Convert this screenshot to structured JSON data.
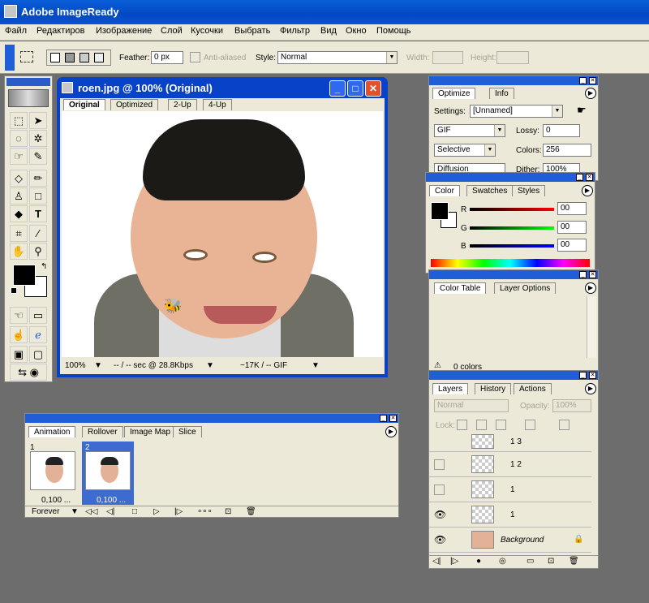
{
  "app": {
    "title": "Adobe ImageReady"
  },
  "menu": [
    "Файл",
    "Редактиров",
    "Изображение",
    "Слой",
    "Кусочки",
    "Выбрать",
    "Фильтр",
    "Вид",
    "Окно",
    "Помощь"
  ],
  "options": {
    "feather_label": "Feather:",
    "feather_value": "0 px",
    "antialiased": "Anti-aliased",
    "style_label": "Style:",
    "style_value": "Normal",
    "width_label": "Width:",
    "height_label": "Height:"
  },
  "document": {
    "title": "roen.jpg @ 100% (Original)",
    "tabs": [
      "Original",
      "Optimized",
      "2-Up",
      "4-Up"
    ],
    "zoom": "100%",
    "speed": "-- / -- sec @ 28.8Kbps",
    "size": "~17K / -- GIF"
  },
  "optimize": {
    "tabs": [
      "Optimize",
      "Info"
    ],
    "settings_label": "Settings:",
    "settings_value": "[Unnamed]",
    "format": "GIF",
    "lossy_label": "Lossy:",
    "lossy_value": "0",
    "palette": "Selective",
    "colors_label": "Colors:",
    "colors_value": "256",
    "dither_algo": "Diffusion",
    "dither_label": "Dither:",
    "dither_value": "100%"
  },
  "color": {
    "tabs": [
      "Color",
      "Swatches",
      "Styles"
    ],
    "r_label": "R",
    "g_label": "G",
    "b_label": "B",
    "r": "00",
    "g": "00",
    "b": "00"
  },
  "colortable": {
    "tabs": [
      "Color Table",
      "Layer Options"
    ],
    "count": "0 colors"
  },
  "layers": {
    "tabs": [
      "Layers",
      "History",
      "Actions"
    ],
    "blend": "Normal",
    "opacity_label": "Opacity:",
    "opacity": "100%",
    "lock_label": "Lock:",
    "rows": [
      {
        "name": "1    3"
      },
      {
        "name": "1    2"
      },
      {
        "name": "1"
      },
      {
        "name": "1"
      },
      {
        "name": "Background"
      }
    ]
  },
  "animation": {
    "tabs": [
      "Animation",
      "Rollover",
      "Image Map",
      "Slice"
    ],
    "frames": [
      {
        "num": "1",
        "delay": "0,100 ..."
      },
      {
        "num": "2",
        "delay": "0,100 ..."
      }
    ],
    "loop": "Forever"
  },
  "colors": {
    "title_bar": "#0a5fd8",
    "panel_bg": "#ece9d8",
    "desktop": "#6d6d6d"
  }
}
